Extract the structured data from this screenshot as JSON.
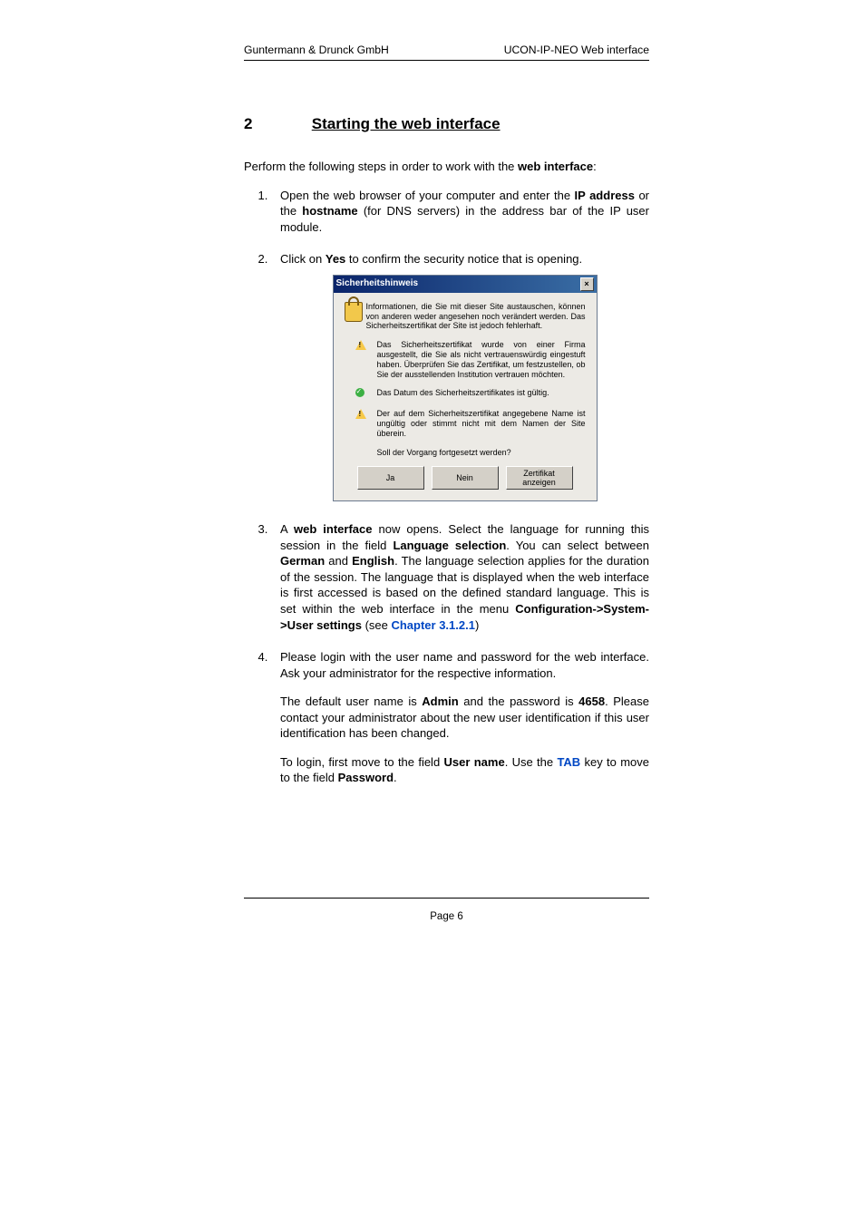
{
  "header": {
    "left": "Guntermann & Drunck GmbH",
    "right": "UCON-IP-NEO Web interface"
  },
  "section": {
    "number": "2",
    "title": "Starting the web interface"
  },
  "intro": {
    "pre": "Perform the following steps in order to work with the ",
    "bold": "web interface",
    "post": ":"
  },
  "steps": {
    "s1": {
      "t1": "Open the web browser of your computer and enter the ",
      "b1": "IP address",
      "t2": " or the ",
      "b2": "hostname",
      "t3": " (for DNS servers) in the address bar of the IP user module."
    },
    "s2": {
      "t1": "Click on ",
      "b1": "Yes",
      "t2": " to confirm the security notice that is opening."
    },
    "s3": {
      "t1": "A ",
      "b1": "web interface",
      "t2": " now opens. Select the language for running this session in the field ",
      "b2": "Language selection",
      "t3": ". You can select between ",
      "b3": "German",
      "t4": " and ",
      "b4": "English",
      "t5": ". The language selection applies for the duration of the session. The language that is displayed when the web interface is first accessed is based on the defined standard language. This is set within the web interface in the menu ",
      "b5": "Configuration->System->User settings",
      "t6": " (see ",
      "link": "Chapter 3.1.2.1",
      "t7": ")"
    },
    "s4": {
      "p1": "Please login with the user name and password for the web interface. Ask your administrator for the respective information.",
      "p2a": "The default user name is ",
      "p2b": "Admin",
      "p2c": " and the password is ",
      "p2d": "4658",
      "p2e": ". Please contact your administrator about the new user identification if this user identification has been changed.",
      "p3a": "To login, first move to the field ",
      "p3b": "User name",
      "p3c": ". Use the ",
      "p3link": "TAB",
      "p3d": " key to move to the field ",
      "p3e": "Password",
      "p3f": "."
    }
  },
  "dialog": {
    "title": "Sicherheitshinweis",
    "intro": "Informationen, die Sie mit dieser Site austauschen, können von anderen weder angesehen noch verändert werden. Das Sicherheitszertifikat der Site ist jedoch fehlerhaft.",
    "warn1": "Das Sicherheitszertifikat wurde von einer Firma ausgestellt, die Sie als nicht vertrauenswürdig eingestuft haben. Überprüfen Sie das Zertifikat, um festzustellen, ob Sie der ausstellenden Institution vertrauen möchten.",
    "ok": "Das Datum des Sicherheitszertifikates ist gültig.",
    "warn2": "Der auf dem Sicherheitszertifikat angegebene Name ist ungültig oder stimmt nicht mit dem Namen der Site überein.",
    "question": "Soll der Vorgang fortgesetzt werden?",
    "buttons": {
      "yes": "Ja",
      "no": "Nein",
      "cert": "Zertifikat anzeigen"
    }
  },
  "footer": "Page 6"
}
